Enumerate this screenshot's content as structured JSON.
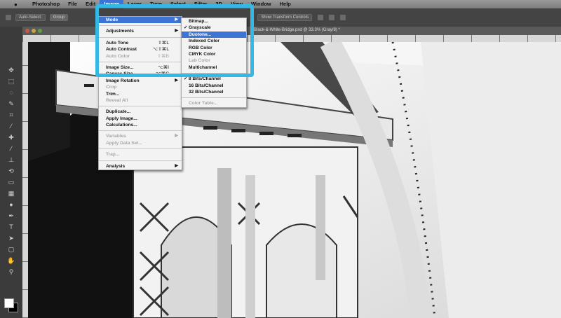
{
  "menubar": {
    "apple": "",
    "items": [
      "Photoshop",
      "File",
      "Edit",
      "Image",
      "Layer",
      "Type",
      "Select",
      "Filter",
      "3D",
      "View",
      "Window",
      "Help"
    ],
    "active_index": 3
  },
  "optionsbar": {
    "auto_select": "Auto-Select:",
    "layer_select": "Group",
    "transform": "Show Transform Controls"
  },
  "document": {
    "title": "Black-&-White-Bridge.psd @ 33.3% (Gray/8) *"
  },
  "image_menu": {
    "items": [
      {
        "label": "Mode",
        "highlighted": true,
        "arrow": true
      },
      {
        "sep": true
      },
      {
        "label": "Adjustments",
        "arrow": true
      },
      {
        "sep": true
      },
      {
        "label": "Auto Tone",
        "shortcut": "⇧⌘L"
      },
      {
        "label": "Auto Contrast",
        "shortcut": "⌥⇧⌘L"
      },
      {
        "label": "Auto Color",
        "shortcut": "⇧⌘B",
        "disabled": true
      },
      {
        "sep": true
      },
      {
        "label": "Image Size...",
        "shortcut": "⌥⌘I"
      },
      {
        "label": "Canvas Size...",
        "shortcut": "⌥⌘C"
      },
      {
        "label": "Image Rotation",
        "arrow": true
      },
      {
        "label": "Crop",
        "disabled": true
      },
      {
        "label": "Trim..."
      },
      {
        "label": "Reveal All",
        "disabled": true
      },
      {
        "sep": true
      },
      {
        "label": "Duplicate..."
      },
      {
        "label": "Apply Image..."
      },
      {
        "label": "Calculations..."
      },
      {
        "sep": true
      },
      {
        "label": "Variables",
        "arrow": true,
        "disabled": true
      },
      {
        "label": "Apply Data Set...",
        "disabled": true
      },
      {
        "sep": true
      },
      {
        "label": "Trap...",
        "disabled": true
      },
      {
        "sep": true
      },
      {
        "label": "Analysis",
        "arrow": true
      }
    ]
  },
  "mode_menu": {
    "items": [
      {
        "label": "Bitmap..."
      },
      {
        "label": "Grayscale",
        "checked": true
      },
      {
        "label": "Duotone...",
        "highlighted": true
      },
      {
        "label": "Indexed Color"
      },
      {
        "label": "RGB Color"
      },
      {
        "label": "CMYK Color"
      },
      {
        "label": "Lab Color",
        "disabled": true
      },
      {
        "label": "Multichannel"
      },
      {
        "sep": true
      },
      {
        "label": "8 Bits/Channel",
        "checked": true
      },
      {
        "label": "16 Bits/Channel"
      },
      {
        "label": "32 Bits/Channel"
      },
      {
        "sep": true
      },
      {
        "label": "Color Table...",
        "disabled": true
      }
    ]
  },
  "colors": {
    "highlight_box": "#33b9e4",
    "menu_selection": "#3d74d6"
  }
}
